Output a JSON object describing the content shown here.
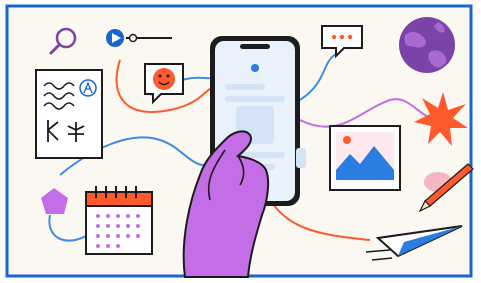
{
  "image": {
    "description_icons": [
      "magnifier-icon",
      "media-player-slider-icon",
      "chat-bubble-icon",
      "globe-icon",
      "handwritten-note-icon",
      "smiley-chat-icon",
      "phone-in-hand-icon",
      "starburst-icon",
      "photo-landscape-icon",
      "pencil-icon",
      "calendar-icon",
      "pentagon-gem-icon",
      "paper-plane-icon"
    ],
    "colors": {
      "background": "#fbf7f1",
      "border_blue": "#1766d1",
      "phone_frame": "#1c1c1c",
      "phone_screen": "#e9f1fb",
      "accent_blue": "#2a7de1",
      "hand_purple": "#c36ee6",
      "orange": "#ff5a2b",
      "pink": "#f4b6c2",
      "globe_purple": "#7a43a8",
      "line_blue": "#3b8de6"
    }
  }
}
